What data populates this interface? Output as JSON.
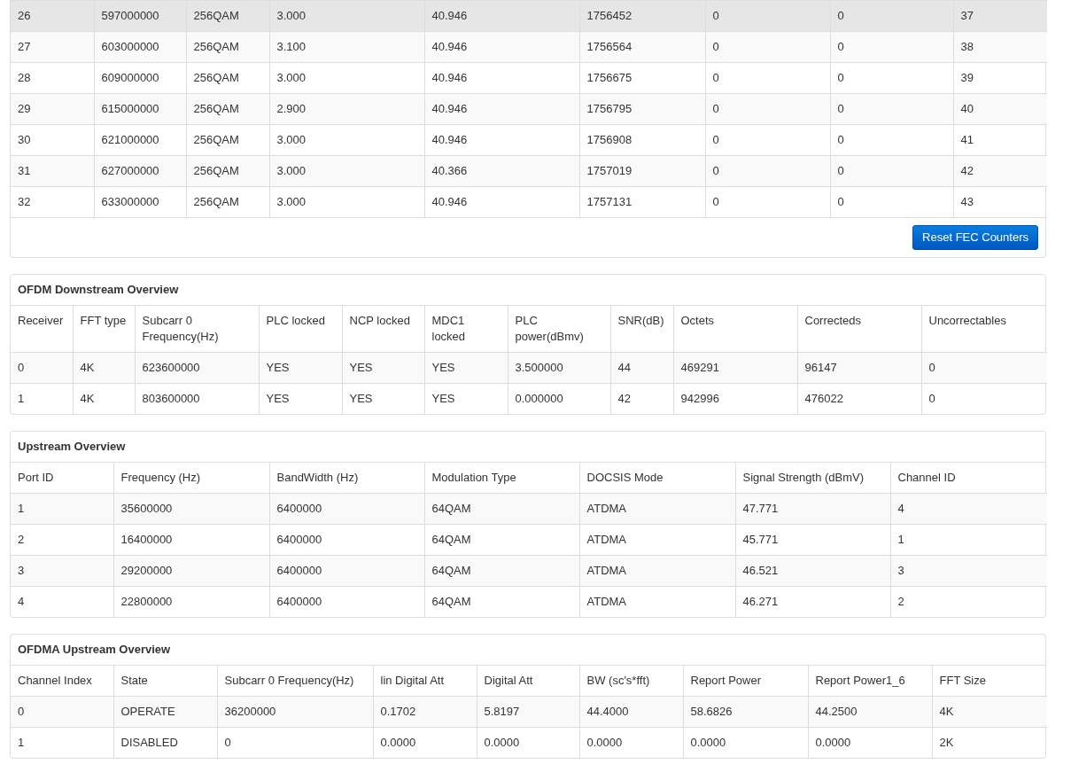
{
  "downstream_table": {
    "rows": [
      {
        "cells": [
          "26",
          "597000000",
          "256QAM",
          "3.000",
          "40.946",
          "1756452",
          "0",
          "0",
          "37"
        ],
        "hovered": true
      },
      {
        "cells": [
          "27",
          "603000000",
          "256QAM",
          "3.100",
          "40.946",
          "1756564",
          "0",
          "0",
          "38"
        ],
        "hovered": false
      },
      {
        "cells": [
          "28",
          "609000000",
          "256QAM",
          "3.000",
          "40.946",
          "1756675",
          "0",
          "0",
          "39"
        ],
        "hovered": false
      },
      {
        "cells": [
          "29",
          "615000000",
          "256QAM",
          "2.900",
          "40.946",
          "1756795",
          "0",
          "0",
          "40"
        ],
        "hovered": false
      },
      {
        "cells": [
          "30",
          "621000000",
          "256QAM",
          "3.000",
          "40.946",
          "1756908",
          "0",
          "0",
          "41"
        ],
        "hovered": false
      },
      {
        "cells": [
          "31",
          "627000000",
          "256QAM",
          "3.000",
          "40.366",
          "1757019",
          "0",
          "0",
          "42"
        ],
        "hovered": false
      },
      {
        "cells": [
          "32",
          "633000000",
          "256QAM",
          "3.000",
          "40.946",
          "1757131",
          "0",
          "0",
          "43"
        ],
        "hovered": false
      }
    ],
    "button": "Reset FEC Counters"
  },
  "ofdm_downstream": {
    "title": "OFDM Downstream Overview",
    "columns": [
      "Receiver",
      "FFT type",
      "Subcarr 0 Frequency(Hz)",
      "PLC locked",
      "NCP locked",
      "MDC1 locked",
      "PLC power(dBmv)",
      "SNR(dB)",
      "Octets",
      "Correcteds",
      "Uncorrectables"
    ],
    "rows": [
      {
        "cells": [
          "0",
          "4K",
          "623600000",
          "YES",
          "YES",
          "YES",
          "3.500000",
          "44",
          "469291",
          "96147",
          "0"
        ]
      },
      {
        "cells": [
          "1",
          "4K",
          "803600000",
          "YES",
          "YES",
          "YES",
          "0.000000",
          "42",
          "942996",
          "476022",
          "0"
        ]
      }
    ]
  },
  "upstream": {
    "title": "Upstream Overview",
    "columns": [
      "Port ID",
      "Frequency (Hz)",
      "BandWidth (Hz)",
      "Modulation Type",
      "DOCSIS Mode",
      "Signal Strength (dBmV)",
      "Channel ID"
    ],
    "rows": [
      {
        "cells": [
          "1",
          "35600000",
          "6400000",
          "64QAM",
          "ATDMA",
          "47.771",
          "4"
        ]
      },
      {
        "cells": [
          "2",
          "16400000",
          "6400000",
          "64QAM",
          "ATDMA",
          "45.771",
          "1"
        ]
      },
      {
        "cells": [
          "3",
          "29200000",
          "6400000",
          "64QAM",
          "ATDMA",
          "46.521",
          "3"
        ]
      },
      {
        "cells": [
          "4",
          "22800000",
          "6400000",
          "64QAM",
          "ATDMA",
          "46.271",
          "2"
        ]
      }
    ]
  },
  "ofdma_upstream": {
    "title": "OFDMA Upstream Overview",
    "columns": [
      "Channel Index",
      "State",
      "Subcarr 0 Frequency(Hz)",
      "lin Digital Att",
      "Digital Att",
      "BW (sc's*fft)",
      "Report Power",
      "Report Power1_6",
      "FFT Size"
    ],
    "rows": [
      {
        "cells": [
          "0",
          "OPERATE",
          "36200000",
          "0.1702",
          "5.8197",
          "44.4000",
          "58.6826",
          "44.2500",
          "4K"
        ]
      },
      {
        "cells": [
          "1",
          "DISABLED",
          "0",
          "0.0000",
          "0.0000",
          "0.0000",
          "0.0000",
          "0.0000",
          "2K"
        ]
      }
    ]
  }
}
